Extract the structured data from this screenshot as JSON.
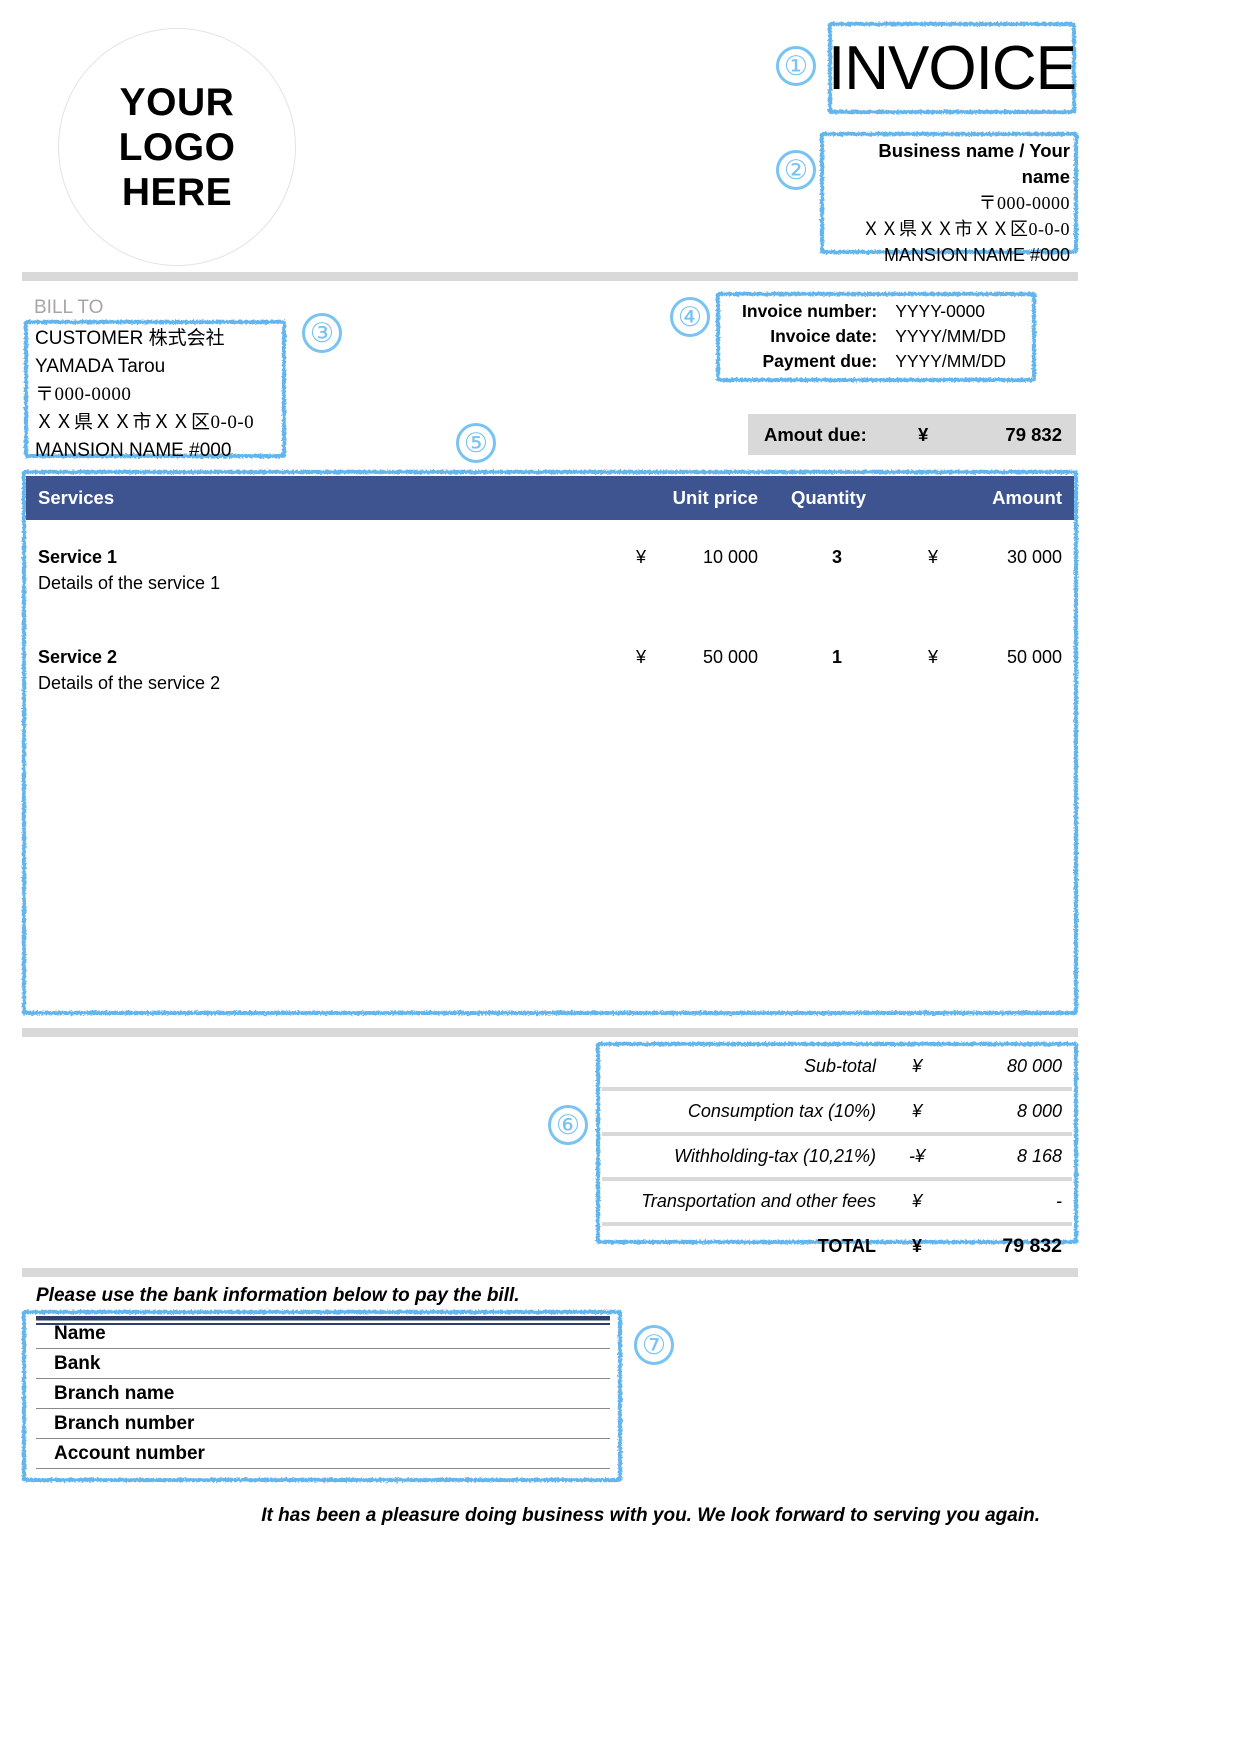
{
  "logo": {
    "line1": "YOUR",
    "line2": "LOGO",
    "line3": "HERE"
  },
  "header": {
    "title": "INVOICE"
  },
  "callouts": {
    "c1": "①",
    "c2": "②",
    "c3": "③",
    "c4": "④",
    "c5": "⑤",
    "c6": "⑥",
    "c7": "⑦"
  },
  "sender": {
    "name": "Business name / Your name",
    "postal": "〒000-0000",
    "address": "ＸＸ県ＸＸ市ＸＸ区0-0-0",
    "building": "MANSION NAME #000"
  },
  "bill_to": {
    "label": "BILL TO",
    "company": "CUSTOMER 株式会社",
    "person": "YAMADA Tarou",
    "postal": "〒000-0000",
    "address": "ＸＸ県ＸＸ市ＸＸ区0-0-0",
    "building": "MANSION NAME #000"
  },
  "meta": {
    "rows": [
      {
        "key": "Invoice number:",
        "value": "YYYY-0000"
      },
      {
        "key": "Invoice date:",
        "value": "YYYY/MM/DD"
      },
      {
        "key": "Payment due:",
        "value": "YYYY/MM/DD"
      }
    ]
  },
  "amount_due": {
    "label": "Amout due:",
    "currency": "¥",
    "value": "79 832"
  },
  "services_table": {
    "columns": {
      "services": "Services",
      "unit_price": "Unit price",
      "quantity": "Quantity",
      "amount": "Amount"
    },
    "currency": "¥",
    "rows": [
      {
        "name": "Service 1",
        "description": "Details of the service 1",
        "unit_price": "10 000",
        "quantity": "3",
        "amount": "30 000"
      },
      {
        "name": "Service 2",
        "description": "Details of the service 2",
        "unit_price": "50 000",
        "quantity": "1",
        "amount": "50 000"
      }
    ]
  },
  "totals": {
    "rows": [
      {
        "label": "Sub-total",
        "currency": "¥",
        "value": "80 000"
      },
      {
        "label": "Consumption tax (10%)",
        "currency": "¥",
        "value": "8 000"
      },
      {
        "label": "Withholding-tax (10,21%)",
        "currency": "-¥",
        "value": "8 168"
      },
      {
        "label": "Transportation and other fees",
        "currency": "¥",
        "value": "-"
      },
      {
        "label": "TOTAL",
        "currency": "¥",
        "value": "79 832"
      }
    ]
  },
  "bank": {
    "note": "Please use the bank information below to pay the bill.",
    "fields": [
      "Name",
      "Bank",
      "Branch name",
      "Branch number",
      "Account number"
    ]
  },
  "footer": {
    "note": "It has been a pleasure doing business with you. We look forward to serving you again."
  },
  "colors": {
    "accent_blue": "#64b5ed",
    "table_header": "#3d5490",
    "gray_bar": "#d9d9d9",
    "bank_line": "#2f3f6b"
  }
}
